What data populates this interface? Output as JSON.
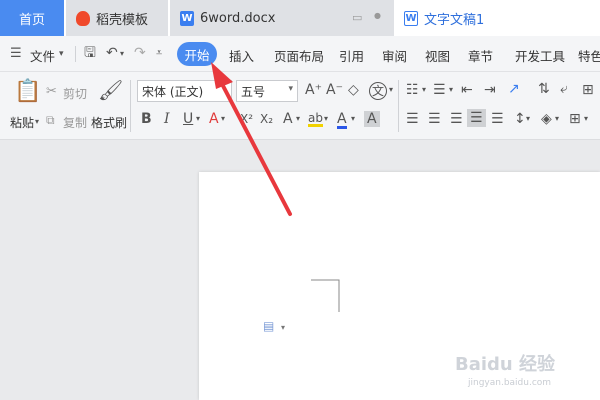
{
  "tabs": {
    "home": "首页",
    "template": "稻壳模板",
    "doc1": "6word.docx",
    "doc2": "文字文稿1",
    "doc_icon_letter": "W"
  },
  "menu": {
    "file": "文件",
    "items": [
      "开始",
      "插入",
      "页面布局",
      "引用",
      "审阅",
      "视图",
      "章节",
      "开发工具",
      "特色"
    ]
  },
  "ribbon": {
    "paste": "粘贴",
    "cut": "剪切",
    "copy": "复制",
    "format_painter": "格式刷",
    "font_name": "宋体 (正文)",
    "font_size": "五号",
    "bold": "B",
    "italic": "I",
    "underline": "U",
    "font_color": "A",
    "superscript": "X²",
    "subscript": "X₂",
    "text_effect": "A",
    "highlight": "ab",
    "font_color2": "A",
    "char_shading": "A",
    "grow": "A⁺",
    "shrink": "A⁻",
    "clear": "◇",
    "pinyin": "文"
  },
  "watermark": {
    "brand": "Baidu 经验",
    "url": "jingyan.baidu.com"
  },
  "colors": {
    "accent": "#4a8bf0",
    "arrow": "#e8383d"
  }
}
